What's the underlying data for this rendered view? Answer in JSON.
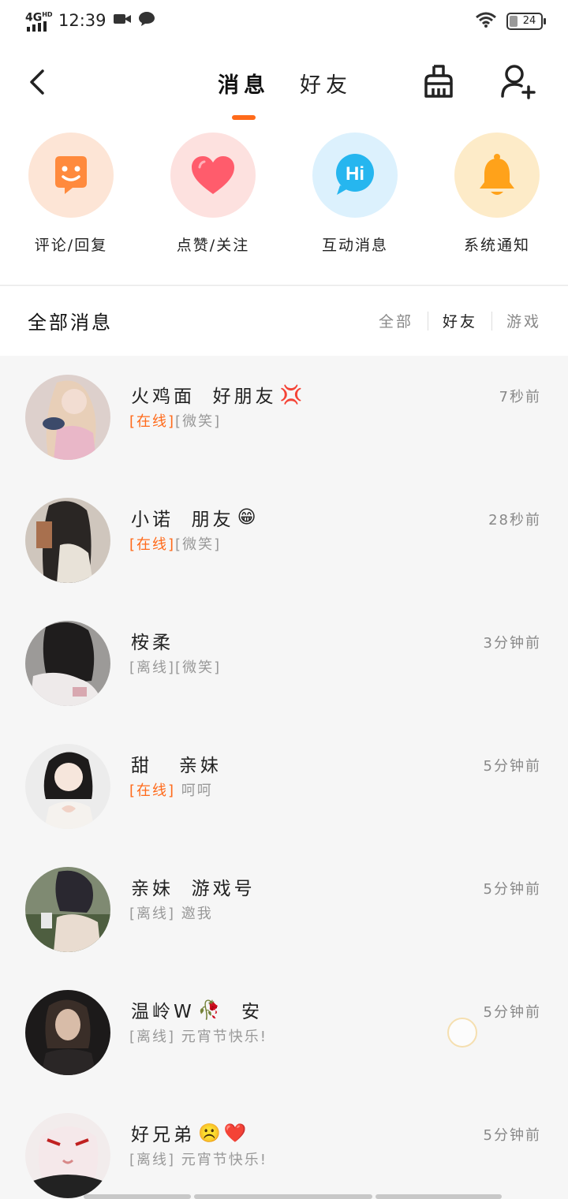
{
  "status_bar": {
    "network": "4G",
    "network_sup": "HD",
    "time": "12:39",
    "battery": "24"
  },
  "nav": {
    "tabs": [
      {
        "label": "消息",
        "active": true
      },
      {
        "label": "好友",
        "active": false
      }
    ],
    "icons": {
      "back": "back-arrow-icon",
      "clean": "clean-brush-icon",
      "add_friend": "add-friend-icon"
    }
  },
  "quick_actions": [
    {
      "label": "评论/回复",
      "icon": "comment-face-icon",
      "bg": "#fde5d6",
      "color": "#ff8a3d"
    },
    {
      "label": "点赞/关注",
      "icon": "heart-icon",
      "bg": "#fde1df",
      "color": "#ff5c6c"
    },
    {
      "label": "互动消息",
      "icon": "hi-bubble-icon",
      "bg": "#dcf1fd",
      "color": "#26b6ef"
    },
    {
      "label": "系统通知",
      "icon": "bell-icon",
      "bg": "#fdebc8",
      "color": "#ffa21a"
    }
  ],
  "filter": {
    "title": "全部消息",
    "options": [
      {
        "label": "全部",
        "active": false
      },
      {
        "label": "好友",
        "active": true
      },
      {
        "label": "游戏",
        "active": false
      }
    ]
  },
  "messages": [
    {
      "name": "火鸡面  好朋友",
      "emoji": "💢",
      "status": "[在线]",
      "online": true,
      "text": "[微笑]",
      "time": "7秒前"
    },
    {
      "name": "小诺  朋友",
      "emoji": "😁",
      "status": "[在线]",
      "online": true,
      "text": "[微笑]",
      "time": "28秒前"
    },
    {
      "name": "桉柔",
      "emoji": "",
      "status": "[离线]",
      "online": false,
      "text": "[微笑]",
      "time": "3分钟前"
    },
    {
      "name": "甜   亲妹",
      "emoji": "",
      "status": "[在线]",
      "online": true,
      "text": " 呵呵",
      "time": "5分钟前"
    },
    {
      "name": "亲妹  游戏号",
      "emoji": "",
      "status": "[离线]",
      "online": false,
      "text": " 邀我",
      "time": "5分钟前"
    },
    {
      "name": "温岭W",
      "emoji": "🥀",
      "name_suffix": "  安",
      "status": "[离线]",
      "online": false,
      "text": " 元宵节快乐!",
      "time": "5分钟前"
    },
    {
      "name": "好兄弟",
      "emoji": "☹️❤️",
      "status": "[离线]",
      "online": false,
      "text": " 元宵节快乐!",
      "time": "5分钟前"
    }
  ],
  "colors": {
    "accent": "#ff6a1a",
    "online": "#ff6a1a",
    "muted": "#999999"
  }
}
